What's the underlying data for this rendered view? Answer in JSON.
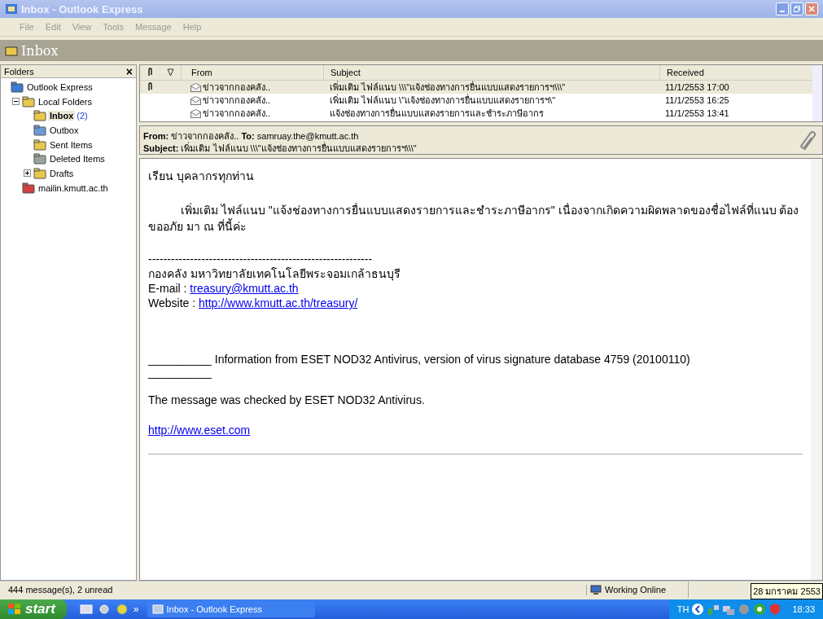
{
  "window": {
    "title": "Inbox - Outlook Express"
  },
  "menu": [
    "File",
    "Edit",
    "View",
    "Tools",
    "Message",
    "Help"
  ],
  "header": {
    "title": "Inbox"
  },
  "folders": {
    "title": "Folders",
    "close": "×",
    "tree": [
      {
        "label": "Outlook Express",
        "selected": false,
        "children": [
          {
            "label": "Local Folders",
            "expanded": true,
            "selected": false,
            "children": [
              {
                "label": "Inbox",
                "count": "(2)",
                "selected": true
              },
              {
                "label": "Outbox",
                "selected": false
              },
              {
                "label": "Sent Items",
                "selected": false
              },
              {
                "label": "Deleted Items",
                "selected": false
              },
              {
                "label": "Drafts",
                "expanded": false,
                "selected": false
              }
            ]
          },
          {
            "label": "mailin.kmutt.ac.th",
            "selected": false
          }
        ]
      }
    ]
  },
  "list": {
    "columns": [
      "From",
      "Subject",
      "Received"
    ],
    "rows": [
      {
        "attachment": true,
        "selected": true,
        "from": "ข่าวจากกองคลัง..",
        "subject": "เพิ่มเติม ไฟล์แนบ \\\\\\\"แจ้งช่องทางการยื่นแบบแสดงรายการฯ\\\\\\\"",
        "received": "11/1/2553 17:00"
      },
      {
        "attachment": false,
        "selected": false,
        "from": "ข่าวจากกองคลัง..",
        "subject": "เพิ่มเติม ไฟล์แนบ \\\"แจ้งช่องทางการยื่นแบบแสดงรายการฯ\\\"",
        "received": "11/1/2553 16:25"
      },
      {
        "attachment": false,
        "selected": false,
        "from": "ข่าวจากกองคลัง..",
        "subject": "แจ้งช่องทางการยื่นแบบแสดงรายการและชำระภาษีอากร",
        "received": "11/1/2553 13:41"
      }
    ]
  },
  "preview": {
    "from_label": "From:",
    "from": "ข่าวจากกองคลัง..",
    "to_label": "To:",
    "to": "samruay.the@kmutt.ac.th",
    "subject_label": "Subject:",
    "subject": "เพิ่มเติม ไฟล์แนบ \\\\\\\"แจ้งช่องทางการยื่นแบบแสดงรายการฯ\\\\\\\"",
    "body": {
      "greeting": "เรียน บุคลากรทุกท่าน",
      "paragraph": "เพิ่มเติม  ไฟล์แนบ \"แจ้งช่องทางการยื่นแบบแสดงรายการและชำระภาษีอากร\"   เนื่องจากเกิดความผิดพลาดของชื่อไฟล์ที่แนบ  ต้องขออภัย มา ณ ที่นี้ค่ะ",
      "dashes": "-----------------------------------------------------------",
      "org": "กองคลัง มหาวิทยาลัยเทคโนโลยีพระจอมเกล้าธนบุรี",
      "email_label": "E-mail     :",
      "email": "treasury@kmutt.ac.th",
      "website_label": "Website   :",
      "website": "http://www.kmutt.ac.th/treasury/",
      "eset_line": "__________ Information from ESET NOD32 Antivirus, version of virus signature database 4759 (20100110)",
      "eset_rule": "__________",
      "checked": "The message was checked by ESET NOD32 Antivirus.",
      "eset_link": "http://www.eset.com"
    }
  },
  "status_bar": {
    "count": "444 message(s), 2 unread",
    "online": "Working Online"
  },
  "taskbar": {
    "start": "start",
    "task": "Inbox - Outlook Express",
    "chevron": "»",
    "lang": "TH",
    "time": "18:33",
    "tooltip": "28 มกราคม 2553"
  }
}
